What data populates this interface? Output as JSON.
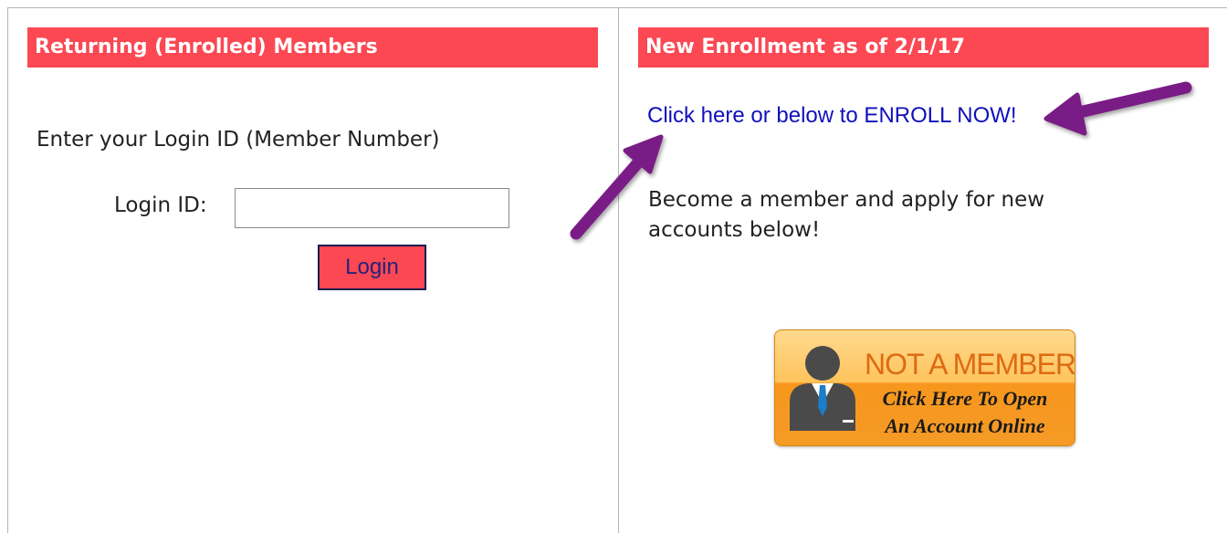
{
  "returning": {
    "header": "Returning (Enrolled) Members",
    "prompt": "Enter your Login ID (Member Number)",
    "login_label": "Login ID:",
    "login_value": "",
    "login_button": "Login"
  },
  "new_enrollment": {
    "header": "New Enrollment as of 2/1/17",
    "enroll_link": "Click here or below to ENROLL NOW!",
    "description": "Become a member and apply for new accounts below!",
    "banner": {
      "title": "NOT A MEMBER?",
      "line1": "Click Here To Open",
      "line2": "An Account Online",
      "icon": "person-with-tie-icon"
    }
  },
  "colors": {
    "header_bg": "#fb4853",
    "link": "#1010bb",
    "arrow": "#7a1f86",
    "banner_orange": "#f7971d"
  }
}
